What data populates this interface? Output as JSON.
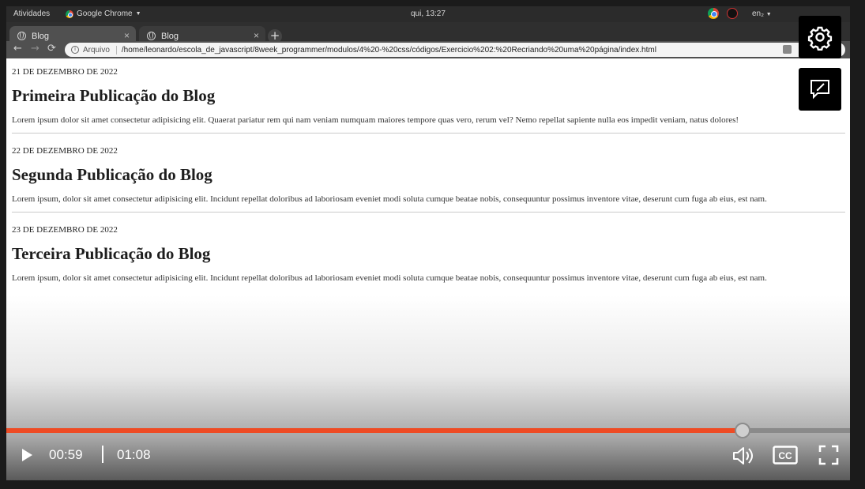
{
  "topbar": {
    "activities": "Atividades",
    "app_name": "Google Chrome",
    "clock": "qui, 13:27",
    "lang": "en₂"
  },
  "browser": {
    "tabs": [
      {
        "label": "Blog",
        "active": true
      },
      {
        "label": "Blog",
        "active": false
      }
    ],
    "address": {
      "scheme_label": "Arquivo",
      "url": "/home/leonardo/escola_de_javascript/8week_programmer/modulos/4%20-%20css/códigos/Exercicio%202:%20Recriando%20uma%20página/index.html"
    }
  },
  "posts": [
    {
      "date": "21 DE DEZEMBRO DE 2022",
      "title": "Primeira Publicação do Blog",
      "body": "Lorem ipsum dolor sit amet consectetur adipisicing elit. Quaerat pariatur rem qui nam veniam numquam maiores tempore quas vero, rerum vel? Nemo repellat sapiente nulla eos impedit veniam, natus dolores!"
    },
    {
      "date": "22 DE DEZEMBRO DE 2022",
      "title": "Segunda Publicação do Blog",
      "body": "Lorem ipsum, dolor sit amet consectetur adipisicing elit. Incidunt repellat doloribus ad laboriosam eveniet modi soluta cumque beatae nobis, consequuntur possimus inventore vitae, deserunt cum fuga ab eius, est nam."
    },
    {
      "date": "23 DE DEZEMBRO DE 2022",
      "title": "Terceira Publicação do Blog",
      "body": "Lorem ipsum, dolor sit amet consectetur adipisicing elit. Incidunt repellat doloribus ad laboriosam eveniet modi soluta cumque beatae nobis, consequuntur possimus inventore vitae, deserunt cum fuga ab eius, est nam."
    }
  ],
  "player": {
    "current_time": "00:59",
    "total_time": "01:08",
    "progress_percent": 87.3,
    "accent_color": "#ee4b24"
  }
}
